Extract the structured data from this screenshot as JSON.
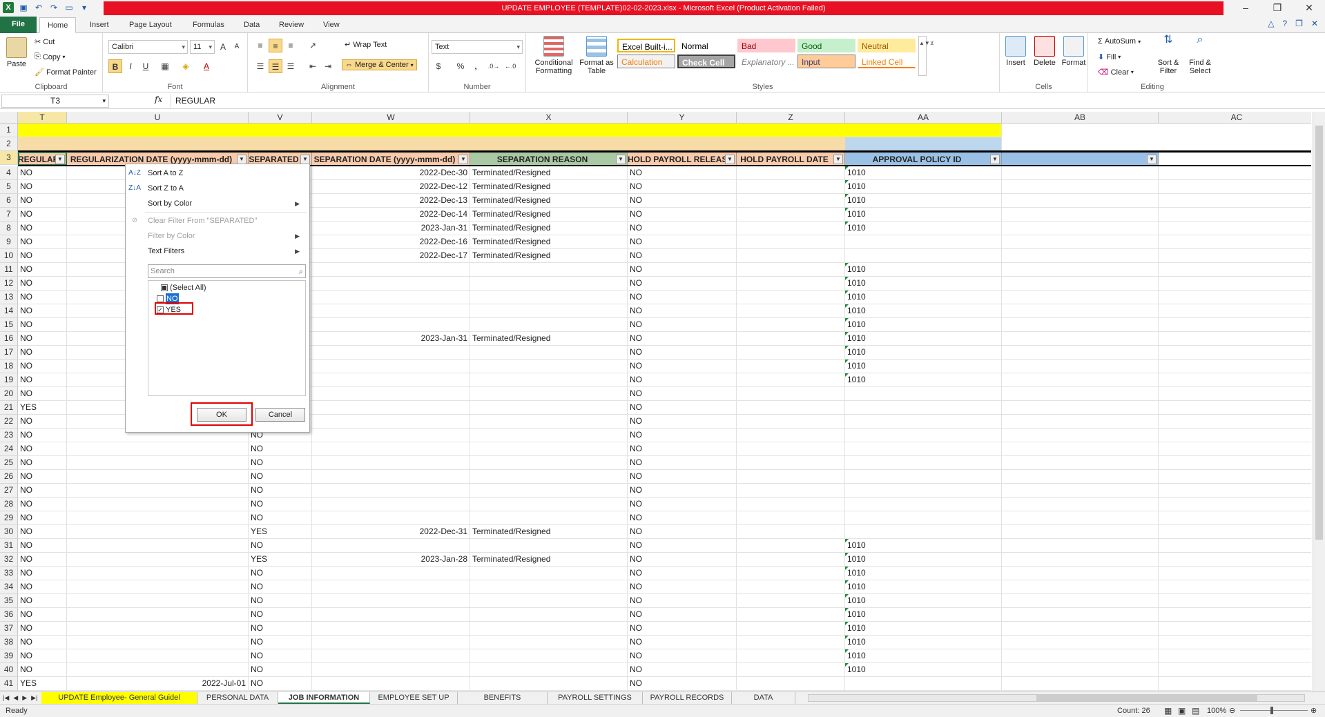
{
  "window": {
    "title": "UPDATE EMPLOYEE (TEMPLATE)02-02-2023.xlsx  -  Microsoft Excel (Product Activation Failed)"
  },
  "ribbon_tabs": [
    "File",
    "Home",
    "Insert",
    "Page Layout",
    "Formulas",
    "Data",
    "Review",
    "View"
  ],
  "clipboard": {
    "paste": "Paste",
    "cut": "Cut",
    "copy": "Copy",
    "format_painter": "Format Painter",
    "label": "Clipboard"
  },
  "font": {
    "name": "Calibri",
    "size": "11",
    "label": "Font",
    "bold": "B",
    "italic": "I",
    "underline": "U"
  },
  "alignment": {
    "wrap_text": "Wrap Text",
    "merge_center": "Merge & Center",
    "label": "Alignment"
  },
  "number": {
    "format": "Text",
    "label": "Number",
    "percent": "%",
    "comma": ","
  },
  "styles": {
    "conditional": "Conditional Formatting",
    "format_table": "Format as Table",
    "label": "Styles",
    "cells": [
      {
        "name": "Excel Built-i...",
        "bg": "#ffffff",
        "fg": "#000000",
        "border": "#f2b600"
      },
      {
        "name": "Normal",
        "bg": "#ffffff",
        "fg": "#000000"
      },
      {
        "name": "Bad",
        "bg": "#ffc7ce",
        "fg": "#9c0006"
      },
      {
        "name": "Good",
        "bg": "#c6efce",
        "fg": "#006100"
      },
      {
        "name": "Neutral",
        "bg": "#ffeb9c",
        "fg": "#9c5700"
      },
      {
        "name": "Calculation",
        "bg": "#f2f2f2",
        "fg": "#fa7d00"
      },
      {
        "name": "Check Cell",
        "bg": "#a5a5a5",
        "fg": "#ffffff"
      },
      {
        "name": "Explanatory ...",
        "bg": "#ffffff",
        "fg": "#7f7f7f"
      },
      {
        "name": "Input",
        "bg": "#ffcc99",
        "fg": "#3f3f76"
      },
      {
        "name": "Linked Cell",
        "bg": "#ffffff",
        "fg": "#fa7d00"
      }
    ]
  },
  "cells_group": {
    "insert": "Insert",
    "delete": "Delete",
    "format": "Format",
    "label": "Cells"
  },
  "editing": {
    "autosum": "AutoSum",
    "fill": "Fill",
    "clear": "Clear",
    "sort_filter": "Sort & Filter",
    "find_select": "Find & Select",
    "label": "Editing"
  },
  "formula_bar": {
    "name_box": "T3",
    "fx": "fx",
    "value": "REGULAR"
  },
  "columns": [
    {
      "letter": "T",
      "w": 71
    },
    {
      "letter": "U",
      "w": 263
    },
    {
      "letter": "V",
      "w": 92
    },
    {
      "letter": "W",
      "w": 229
    },
    {
      "letter": "X",
      "w": 228
    },
    {
      "letter": "Y",
      "w": 158
    },
    {
      "letter": "Z",
      "w": 157
    },
    {
      "letter": "AA",
      "w": 227
    },
    {
      "letter": "AB",
      "w": 227
    },
    {
      "letter": "AC",
      "w": 227
    }
  ],
  "header_row": [
    "REGULAR",
    "REGULARIZATION DATE (yyyy-mmm-dd)",
    "SEPARATED",
    "SEPARATION DATE (yyyy-mmm-dd)",
    "SEPARATION REASON",
    "HOLD PAYROLL RELEASE",
    "HOLD PAYROLL DATE",
    "APPROVAL POLICY ID",
    ""
  ],
  "rows": [
    {
      "n": "4",
      "t": "NO",
      "u": "",
      "v": "",
      "w": "2022-Dec-30",
      "x": "Terminated/Resigned",
      "y": "NO",
      "aa": "1010"
    },
    {
      "n": "5",
      "t": "NO",
      "u": "",
      "v": "",
      "w": "2022-Dec-12",
      "x": "Terminated/Resigned",
      "y": "NO",
      "aa": "1010"
    },
    {
      "n": "6",
      "t": "NO",
      "u": "",
      "v": "",
      "w": "2022-Dec-13",
      "x": "Terminated/Resigned",
      "y": "NO",
      "aa": "1010"
    },
    {
      "n": "7",
      "t": "NO",
      "u": "",
      "v": "",
      "w": "2022-Dec-14",
      "x": "Terminated/Resigned",
      "y": "NO",
      "aa": "1010"
    },
    {
      "n": "8",
      "t": "NO",
      "u": "",
      "v": "",
      "w": "2023-Jan-31",
      "x": "Terminated/Resigned",
      "y": "NO",
      "aa": "1010"
    },
    {
      "n": "9",
      "t": "NO",
      "u": "",
      "v": "",
      "w": "2022-Dec-16",
      "x": "Terminated/Resigned",
      "y": "NO",
      "aa": ""
    },
    {
      "n": "10",
      "t": "NO",
      "u": "",
      "v": "",
      "w": "2022-Dec-17",
      "x": "Terminated/Resigned",
      "y": "NO",
      "aa": ""
    },
    {
      "n": "11",
      "t": "NO",
      "u": "",
      "v": "",
      "w": "",
      "x": "",
      "y": "NO",
      "aa": "1010"
    },
    {
      "n": "12",
      "t": "NO",
      "u": "",
      "v": "",
      "w": "",
      "x": "",
      "y": "NO",
      "aa": "1010"
    },
    {
      "n": "13",
      "t": "NO",
      "u": "",
      "v": "",
      "w": "",
      "x": "",
      "y": "NO",
      "aa": "1010"
    },
    {
      "n": "14",
      "t": "NO",
      "u": "",
      "v": "",
      "w": "",
      "x": "",
      "y": "NO",
      "aa": "1010"
    },
    {
      "n": "15",
      "t": "NO",
      "u": "",
      "v": "",
      "w": "",
      "x": "",
      "y": "NO",
      "aa": "1010"
    },
    {
      "n": "16",
      "t": "NO",
      "u": "",
      "v": "",
      "w": "2023-Jan-31",
      "x": "Terminated/Resigned",
      "y": "NO",
      "aa": "1010"
    },
    {
      "n": "17",
      "t": "NO",
      "u": "",
      "v": "",
      "w": "",
      "x": "",
      "y": "NO",
      "aa": "1010"
    },
    {
      "n": "18",
      "t": "NO",
      "u": "",
      "v": "",
      "w": "",
      "x": "",
      "y": "NO",
      "aa": "1010"
    },
    {
      "n": "19",
      "t": "NO",
      "u": "",
      "v": "",
      "w": "",
      "x": "",
      "y": "NO",
      "aa": "1010"
    },
    {
      "n": "20",
      "t": "NO",
      "u": "",
      "v": "",
      "w": "",
      "x": "",
      "y": "NO",
      "aa": ""
    },
    {
      "n": "21",
      "t": "YES",
      "u": "",
      "v": "",
      "w": "",
      "x": "",
      "y": "NO",
      "aa": ""
    },
    {
      "n": "22",
      "t": "NO",
      "u": "",
      "v": "",
      "w": "",
      "x": "",
      "y": "NO",
      "aa": ""
    },
    {
      "n": "23",
      "t": "NO",
      "u": "",
      "v": "NO",
      "w": "",
      "x": "",
      "y": "NO",
      "aa": ""
    },
    {
      "n": "24",
      "t": "NO",
      "u": "",
      "v": "NO",
      "w": "",
      "x": "",
      "y": "NO",
      "aa": ""
    },
    {
      "n": "25",
      "t": "NO",
      "u": "",
      "v": "NO",
      "w": "",
      "x": "",
      "y": "NO",
      "aa": ""
    },
    {
      "n": "26",
      "t": "NO",
      "u": "",
      "v": "NO",
      "w": "",
      "x": "",
      "y": "NO",
      "aa": ""
    },
    {
      "n": "27",
      "t": "NO",
      "u": "",
      "v": "NO",
      "w": "",
      "x": "",
      "y": "NO",
      "aa": ""
    },
    {
      "n": "28",
      "t": "NO",
      "u": "",
      "v": "NO",
      "w": "",
      "x": "",
      "y": "NO",
      "aa": ""
    },
    {
      "n": "29",
      "t": "NO",
      "u": "",
      "v": "NO",
      "w": "",
      "x": "",
      "y": "NO",
      "aa": ""
    },
    {
      "n": "30",
      "t": "NO",
      "u": "",
      "v": "YES",
      "w": "2022-Dec-31",
      "x": "Terminated/Resigned",
      "y": "NO",
      "aa": ""
    },
    {
      "n": "31",
      "t": "NO",
      "u": "",
      "v": "NO",
      "w": "",
      "x": "",
      "y": "NO",
      "aa": "1010"
    },
    {
      "n": "32",
      "t": "NO",
      "u": "",
      "v": "YES",
      "w": "2023-Jan-28",
      "x": "Terminated/Resigned",
      "y": "NO",
      "aa": "1010"
    },
    {
      "n": "33",
      "t": "NO",
      "u": "",
      "v": "NO",
      "w": "",
      "x": "",
      "y": "NO",
      "aa": "1010"
    },
    {
      "n": "34",
      "t": "NO",
      "u": "",
      "v": "NO",
      "w": "",
      "x": "",
      "y": "NO",
      "aa": "1010"
    },
    {
      "n": "35",
      "t": "NO",
      "u": "",
      "v": "NO",
      "w": "",
      "x": "",
      "y": "NO",
      "aa": "1010"
    },
    {
      "n": "36",
      "t": "NO",
      "u": "",
      "v": "NO",
      "w": "",
      "x": "",
      "y": "NO",
      "aa": "1010"
    },
    {
      "n": "37",
      "t": "NO",
      "u": "",
      "v": "NO",
      "w": "",
      "x": "",
      "y": "NO",
      "aa": "1010"
    },
    {
      "n": "38",
      "t": "NO",
      "u": "",
      "v": "NO",
      "w": "",
      "x": "",
      "y": "NO",
      "aa": "1010"
    },
    {
      "n": "39",
      "t": "NO",
      "u": "",
      "v": "NO",
      "w": "",
      "x": "",
      "y": "NO",
      "aa": "1010"
    },
    {
      "n": "40",
      "t": "NO",
      "u": "",
      "v": "NO",
      "w": "",
      "x": "",
      "y": "NO",
      "aa": "1010"
    },
    {
      "n": "41",
      "t": "YES",
      "u": "2022-Jul-01",
      "v": "NO",
      "w": "",
      "x": "",
      "y": "NO",
      "aa": ""
    }
  ],
  "filter_menu": {
    "sort_az": "Sort A to Z",
    "sort_za": "Sort Z to A",
    "sort_color": "Sort by Color",
    "clear_filter": "Clear Filter From \"SEPARATED\"",
    "filter_color": "Filter by Color",
    "text_filters": "Text Filters",
    "search_placeholder": "Search",
    "items": [
      {
        "label": "(Select All)",
        "state": "partial"
      },
      {
        "label": "NO",
        "state": "unchecked"
      },
      {
        "label": "YES",
        "state": "checked"
      }
    ],
    "ok": "OK",
    "cancel": "Cancel"
  },
  "sheet_tabs": [
    {
      "name": "UPDATE Employee- General Guidel",
      "style": "yel"
    },
    {
      "name": "PERSONAL DATA",
      "style": ""
    },
    {
      "name": "JOB INFORMATION",
      "style": "active"
    },
    {
      "name": "EMPLOYEE SET UP",
      "style": ""
    },
    {
      "name": "BENEFITS PACKAGE",
      "style": ""
    },
    {
      "name": "PAYROLL SETTINGS",
      "style": ""
    },
    {
      "name": "PAYROLL RECORDS",
      "style": ""
    },
    {
      "name": "DATA MIGRAT",
      "style": ""
    }
  ],
  "status": {
    "ready": "Ready",
    "count": "Count: 26",
    "zoom": "100%"
  },
  "colors": {
    "header_green": "#a9c9a4",
    "header_blue": "#9bc2e6",
    "header_orange": "#f8cbad",
    "yellow": "#ffff00",
    "tan": "#f8dca8",
    "lightblue": "#bdd7ee"
  }
}
